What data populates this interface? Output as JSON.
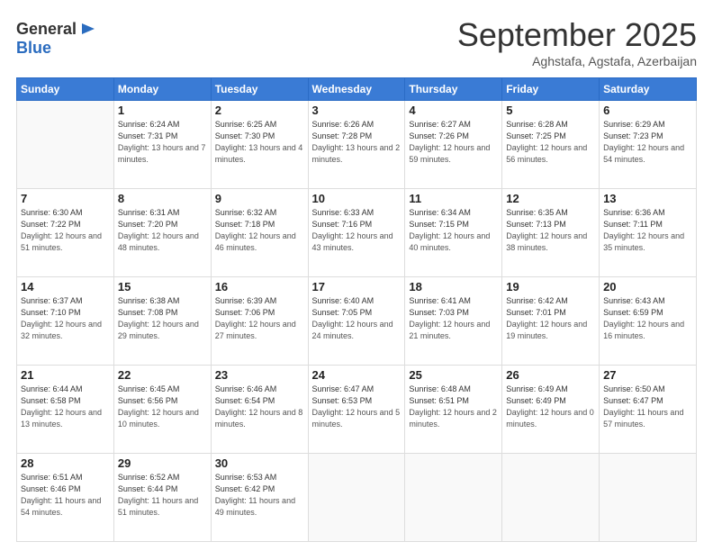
{
  "logo": {
    "general": "General",
    "blue": "Blue"
  },
  "header": {
    "month": "September 2025",
    "subtitle": "Aghstafa, Agstafa, Azerbaijan"
  },
  "weekdays": [
    "Sunday",
    "Monday",
    "Tuesday",
    "Wednesday",
    "Thursday",
    "Friday",
    "Saturday"
  ],
  "weeks": [
    [
      {
        "day": "",
        "sunrise": "",
        "sunset": "",
        "daylight": ""
      },
      {
        "day": "1",
        "sunrise": "6:24 AM",
        "sunset": "7:31 PM",
        "daylight": "13 hours and 7 minutes."
      },
      {
        "day": "2",
        "sunrise": "6:25 AM",
        "sunset": "7:30 PM",
        "daylight": "13 hours and 4 minutes."
      },
      {
        "day": "3",
        "sunrise": "6:26 AM",
        "sunset": "7:28 PM",
        "daylight": "13 hours and 2 minutes."
      },
      {
        "day": "4",
        "sunrise": "6:27 AM",
        "sunset": "7:26 PM",
        "daylight": "12 hours and 59 minutes."
      },
      {
        "day": "5",
        "sunrise": "6:28 AM",
        "sunset": "7:25 PM",
        "daylight": "12 hours and 56 minutes."
      },
      {
        "day": "6",
        "sunrise": "6:29 AM",
        "sunset": "7:23 PM",
        "daylight": "12 hours and 54 minutes."
      }
    ],
    [
      {
        "day": "7",
        "sunrise": "6:30 AM",
        "sunset": "7:22 PM",
        "daylight": "12 hours and 51 minutes."
      },
      {
        "day": "8",
        "sunrise": "6:31 AM",
        "sunset": "7:20 PM",
        "daylight": "12 hours and 48 minutes."
      },
      {
        "day": "9",
        "sunrise": "6:32 AM",
        "sunset": "7:18 PM",
        "daylight": "12 hours and 46 minutes."
      },
      {
        "day": "10",
        "sunrise": "6:33 AM",
        "sunset": "7:16 PM",
        "daylight": "12 hours and 43 minutes."
      },
      {
        "day": "11",
        "sunrise": "6:34 AM",
        "sunset": "7:15 PM",
        "daylight": "12 hours and 40 minutes."
      },
      {
        "day": "12",
        "sunrise": "6:35 AM",
        "sunset": "7:13 PM",
        "daylight": "12 hours and 38 minutes."
      },
      {
        "day": "13",
        "sunrise": "6:36 AM",
        "sunset": "7:11 PM",
        "daylight": "12 hours and 35 minutes."
      }
    ],
    [
      {
        "day": "14",
        "sunrise": "6:37 AM",
        "sunset": "7:10 PM",
        "daylight": "12 hours and 32 minutes."
      },
      {
        "day": "15",
        "sunrise": "6:38 AM",
        "sunset": "7:08 PM",
        "daylight": "12 hours and 29 minutes."
      },
      {
        "day": "16",
        "sunrise": "6:39 AM",
        "sunset": "7:06 PM",
        "daylight": "12 hours and 27 minutes."
      },
      {
        "day": "17",
        "sunrise": "6:40 AM",
        "sunset": "7:05 PM",
        "daylight": "12 hours and 24 minutes."
      },
      {
        "day": "18",
        "sunrise": "6:41 AM",
        "sunset": "7:03 PM",
        "daylight": "12 hours and 21 minutes."
      },
      {
        "day": "19",
        "sunrise": "6:42 AM",
        "sunset": "7:01 PM",
        "daylight": "12 hours and 19 minutes."
      },
      {
        "day": "20",
        "sunrise": "6:43 AM",
        "sunset": "6:59 PM",
        "daylight": "12 hours and 16 minutes."
      }
    ],
    [
      {
        "day": "21",
        "sunrise": "6:44 AM",
        "sunset": "6:58 PM",
        "daylight": "12 hours and 13 minutes."
      },
      {
        "day": "22",
        "sunrise": "6:45 AM",
        "sunset": "6:56 PM",
        "daylight": "12 hours and 10 minutes."
      },
      {
        "day": "23",
        "sunrise": "6:46 AM",
        "sunset": "6:54 PM",
        "daylight": "12 hours and 8 minutes."
      },
      {
        "day": "24",
        "sunrise": "6:47 AM",
        "sunset": "6:53 PM",
        "daylight": "12 hours and 5 minutes."
      },
      {
        "day": "25",
        "sunrise": "6:48 AM",
        "sunset": "6:51 PM",
        "daylight": "12 hours and 2 minutes."
      },
      {
        "day": "26",
        "sunrise": "6:49 AM",
        "sunset": "6:49 PM",
        "daylight": "12 hours and 0 minutes."
      },
      {
        "day": "27",
        "sunrise": "6:50 AM",
        "sunset": "6:47 PM",
        "daylight": "11 hours and 57 minutes."
      }
    ],
    [
      {
        "day": "28",
        "sunrise": "6:51 AM",
        "sunset": "6:46 PM",
        "daylight": "11 hours and 54 minutes."
      },
      {
        "day": "29",
        "sunrise": "6:52 AM",
        "sunset": "6:44 PM",
        "daylight": "11 hours and 51 minutes."
      },
      {
        "day": "30",
        "sunrise": "6:53 AM",
        "sunset": "6:42 PM",
        "daylight": "11 hours and 49 minutes."
      },
      {
        "day": "",
        "sunrise": "",
        "sunset": "",
        "daylight": ""
      },
      {
        "day": "",
        "sunrise": "",
        "sunset": "",
        "daylight": ""
      },
      {
        "day": "",
        "sunrise": "",
        "sunset": "",
        "daylight": ""
      },
      {
        "day": "",
        "sunrise": "",
        "sunset": "",
        "daylight": ""
      }
    ]
  ],
  "labels": {
    "sunrise_prefix": "Sunrise: ",
    "sunset_prefix": "Sunset: ",
    "daylight_prefix": "Daylight: "
  }
}
